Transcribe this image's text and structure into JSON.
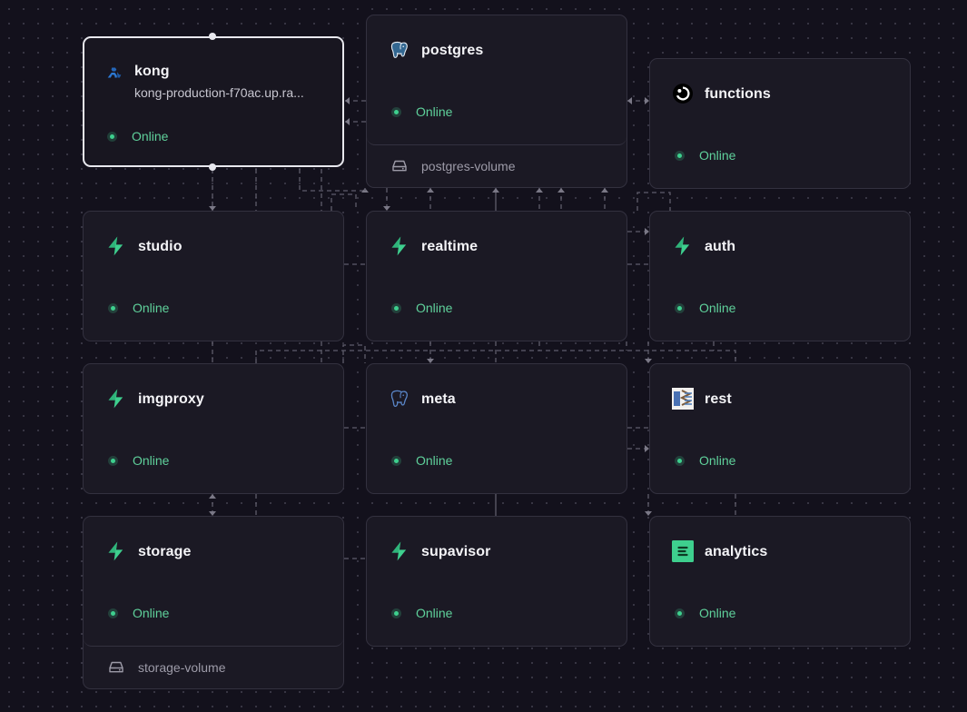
{
  "colors": {
    "background": "#13111c",
    "card": "#1b1924",
    "border": "#33313f",
    "online": "#3ecf8e",
    "edge": "#5f5d6b"
  },
  "services": [
    {
      "id": "kong",
      "name": "kong",
      "url": "kong-production-f70ac.up.ra...",
      "status": "Online",
      "icon": "kong-icon",
      "selected": true
    },
    {
      "id": "postgres",
      "name": "postgres",
      "status": "Online",
      "icon": "postgres-elephant-icon",
      "volume": "postgres-volume"
    },
    {
      "id": "functions",
      "name": "functions",
      "status": "Online",
      "icon": "functions-icon"
    },
    {
      "id": "studio",
      "name": "studio",
      "status": "Online",
      "icon": "supabase-bolt-icon"
    },
    {
      "id": "realtime",
      "name": "realtime",
      "status": "Online",
      "icon": "supabase-bolt-icon"
    },
    {
      "id": "auth",
      "name": "auth",
      "status": "Online",
      "icon": "supabase-bolt-icon"
    },
    {
      "id": "imgproxy",
      "name": "imgproxy",
      "status": "Online",
      "icon": "supabase-bolt-icon"
    },
    {
      "id": "meta",
      "name": "meta",
      "status": "Online",
      "icon": "postgres-elephant-outline-icon"
    },
    {
      "id": "rest",
      "name": "rest",
      "status": "Online",
      "icon": "postgrest-icon"
    },
    {
      "id": "storage",
      "name": "storage",
      "status": "Online",
      "icon": "supabase-bolt-icon",
      "volume": "storage-volume"
    },
    {
      "id": "supavisor",
      "name": "supavisor",
      "status": "Online",
      "icon": "supabase-bolt-icon"
    },
    {
      "id": "analytics",
      "name": "analytics",
      "status": "Online",
      "icon": "analytics-icon"
    }
  ]
}
